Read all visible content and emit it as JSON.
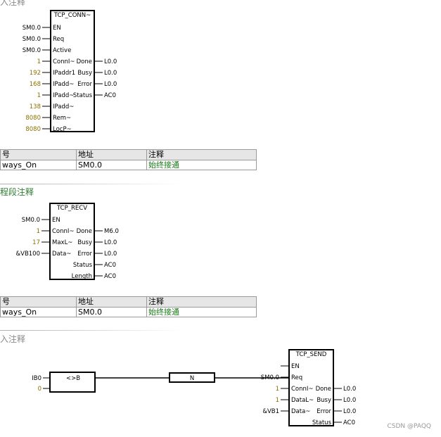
{
  "comments": {
    "top": "入注释",
    "mid": "程段注释",
    "bottom": "入注释"
  },
  "symbol_table_1": {
    "headers": [
      "号",
      "地址",
      "注释"
    ],
    "row": [
      "ways_On",
      "SM0.0",
      "始终接通"
    ]
  },
  "symbol_table_2": {
    "headers": [
      "号",
      "地址",
      "注释"
    ],
    "row": [
      "ways_On",
      "SM0.0",
      "始终接通"
    ]
  },
  "tcp_conn": {
    "title": "TCP_CONN~",
    "inputs": [
      {
        "param": "",
        "label": "EN",
        "value": "SM0.0",
        "olive": false
      },
      {
        "param": "",
        "label": "Req",
        "value": "SM0.0",
        "olive": false
      },
      {
        "param": "",
        "label": "Active",
        "value": "SM0.0",
        "olive": false
      },
      {
        "param": "",
        "label": "ConnI~",
        "value": "1",
        "olive": true
      },
      {
        "param": "",
        "label": "IPaddr1",
        "value": "192",
        "olive": true
      },
      {
        "param": "",
        "label": "IPadd~",
        "value": "168",
        "olive": true
      },
      {
        "param": "",
        "label": "IPadd~",
        "value": "1",
        "olive": true
      },
      {
        "param": "",
        "label": "IPadd~",
        "value": "138",
        "olive": true
      },
      {
        "param": "",
        "label": "Rem~",
        "value": "8080",
        "olive": true
      },
      {
        "param": "",
        "label": "LocP~",
        "value": "8080",
        "olive": true
      }
    ],
    "outputs": [
      {
        "label": "Done",
        "value": "L0.0",
        "row": 3
      },
      {
        "label": "Busy",
        "value": "L0.0",
        "row": 4
      },
      {
        "label": "Error",
        "value": "L0.0",
        "row": 5
      },
      {
        "label": "Status",
        "value": "AC0",
        "row": 6
      }
    ]
  },
  "tcp_recv": {
    "title": "TCP_RECV",
    "inputs": [
      {
        "label": "EN",
        "value": "SM0.0",
        "olive": false
      },
      {
        "label": "ConnI~",
        "value": "1",
        "olive": true
      },
      {
        "label": "MaxL~",
        "value": "17",
        "olive": true
      },
      {
        "label": "Data~",
        "value": "&VB100",
        "olive": false
      }
    ],
    "outputs": [
      {
        "label": "Done",
        "value": "M6.0",
        "row": 1
      },
      {
        "label": "Busy",
        "value": "L0.0",
        "row": 2
      },
      {
        "label": "Error",
        "value": "L0.0",
        "row": 3
      },
      {
        "label": "Status",
        "value": "AC0",
        "row": 4
      },
      {
        "label": "Length",
        "value": "AC0",
        "row": 5
      }
    ]
  },
  "compare": {
    "title": "<>B",
    "in1": "IB0",
    "in2": "0"
  },
  "not_contact": {
    "label": "N"
  },
  "tcp_send": {
    "title": "TCP_SEND",
    "inputs": [
      {
        "label": "EN",
        "value": "",
        "olive": false
      },
      {
        "label": "Req",
        "value": "SM0.0",
        "olive": false
      },
      {
        "label": "ConnI~",
        "value": "1",
        "olive": true
      },
      {
        "label": "DataL~",
        "value": "1",
        "olive": true
      },
      {
        "label": "Data~",
        "value": "&VB1",
        "olive": false
      }
    ],
    "outputs": [
      {
        "label": "Done",
        "value": "L0.0",
        "row": 2
      },
      {
        "label": "Busy",
        "value": "L0.0",
        "row": 3
      },
      {
        "label": "Error",
        "value": "L0.0",
        "row": 4
      },
      {
        "label": "Status",
        "value": "AC0",
        "row": 5
      }
    ]
  },
  "watermark": "CSDN @PAQQ",
  "colors": {
    "olive_value": "#8a7000",
    "comment_green": "#1a7a1a",
    "comment_gray": "#8a8a8a",
    "header_bg": "#e6e6e6"
  }
}
